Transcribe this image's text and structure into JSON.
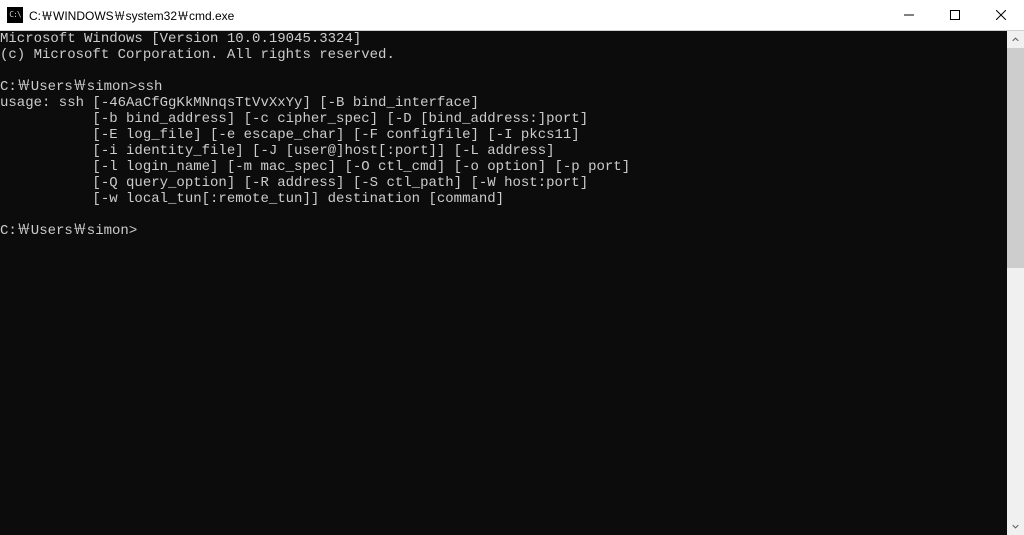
{
  "titlebar": {
    "icon_text": "C:\\",
    "title": "C:￦WINDOWS￦system32￦cmd.exe"
  },
  "terminal": {
    "lines": [
      "Microsoft Windows [Version 10.0.19045.3324]",
      "(c) Microsoft Corporation. All rights reserved.",
      "",
      "C:￦Users￦simon>ssh",
      "usage: ssh [-46AaCfGgKkMNnqsTtVvXxYy] [-B bind_interface]",
      "           [-b bind_address] [-c cipher_spec] [-D [bind_address:]port]",
      "           [-E log_file] [-e escape_char] [-F configfile] [-I pkcs11]",
      "           [-i identity_file] [-J [user@]host[:port]] [-L address]",
      "           [-l login_name] [-m mac_spec] [-O ctl_cmd] [-o option] [-p port]",
      "           [-Q query_option] [-R address] [-S ctl_path] [-W host:port]",
      "           [-w local_tun[:remote_tun]] destination [command]",
      "",
      "C:￦Users￦simon>"
    ]
  }
}
